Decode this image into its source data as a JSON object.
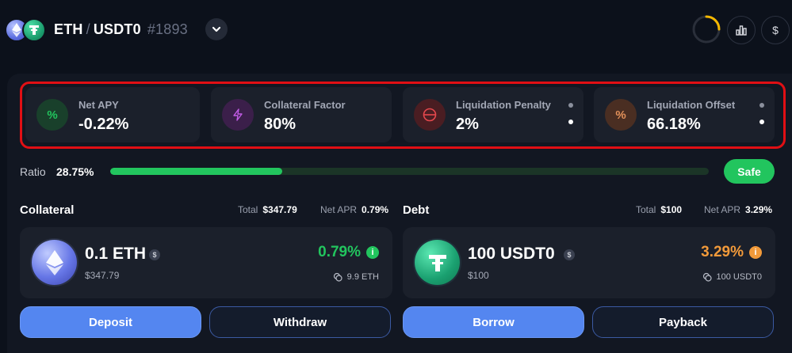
{
  "header": {
    "base_asset": "ETH",
    "separator": "/",
    "quote_asset": "USDT0",
    "position_id": "#1893",
    "icons": [
      "eth-coin-icon",
      "usdt-coin-icon",
      "chevron-down-icon",
      "loading-spinner-icon",
      "bar-chart-icon",
      "dollar-icon"
    ],
    "dollar_symbol": "$"
  },
  "stats": [
    {
      "label": "Net APY",
      "value": "-0.22%",
      "icon_glyph": "%",
      "icon": "percent-icon",
      "accent": "#22c55e"
    },
    {
      "label": "Collateral Factor",
      "value": "80%",
      "icon_glyph": "⚡",
      "icon": "lightning-icon",
      "accent": "#b14fd8"
    },
    {
      "label": "Liquidation Penalty",
      "value": "2%",
      "icon_glyph": "⊖",
      "icon": "minus-circle-icon",
      "accent": "#e5484d"
    },
    {
      "label": "Liquidation Offset",
      "value": "66.18%",
      "icon_glyph": "%",
      "icon": "percent-icon",
      "accent": "#e3915a"
    }
  ],
  "ratio": {
    "label": "Ratio",
    "value": "28.75%",
    "fill_percent": 28.75,
    "status": "Safe",
    "status_color": "#22c55e"
  },
  "collateral": {
    "title": "Collateral",
    "total_label": "Total",
    "total_value": "$347.79",
    "apr_label": "Net APR",
    "apr_value": "0.79%",
    "amount": "0.1 ETH",
    "usd_value": "$347.79",
    "rate": "0.79%",
    "rate_color": "#22c55e",
    "sub_amount": "9.9 ETH",
    "usd_badge": "$",
    "info_glyph": "i"
  },
  "debt": {
    "title": "Debt",
    "total_label": "Total",
    "total_value": "$100",
    "apr_label": "Net APR",
    "apr_value": "3.29%",
    "amount": "100 USDT0",
    "usd_value": "$100",
    "rate": "3.29%",
    "rate_color": "#f29a3a",
    "sub_amount": "100 USDT0",
    "usd_badge": "$",
    "info_glyph": "i"
  },
  "buttons": {
    "deposit": "Deposit",
    "withdraw": "Withdraw",
    "borrow": "Borrow",
    "payback": "Payback"
  },
  "colors": {
    "background": "#0c111b",
    "panel": "#121722",
    "card": "#1b202b",
    "primary_button": "#5486f0",
    "highlight_border": "#e10f14"
  }
}
